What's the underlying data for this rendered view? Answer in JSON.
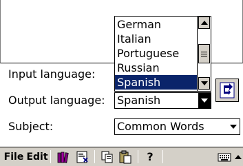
{
  "dropdown": {
    "items": [
      "German",
      "Italian",
      "Portuguese",
      "Russian",
      "Spanish"
    ],
    "selected_index": 4
  },
  "form": {
    "input_label": "Input language:",
    "output_label": "Output language:",
    "output_value": "Spanish",
    "subject_label": "Subject:",
    "subject_value": "Common Words"
  },
  "toolbar": {
    "file_label": "File",
    "edit_label": "Edit",
    "help_label": "?",
    "icons": [
      "books-icon",
      "properties-icon",
      "copy-icon",
      "paste-icon",
      "keyboard-icon",
      "up-arrow-icon"
    ]
  },
  "colors": {
    "selection": "#0a246a",
    "toolbar_bg": "#d4d0c8",
    "books": "#800080"
  }
}
